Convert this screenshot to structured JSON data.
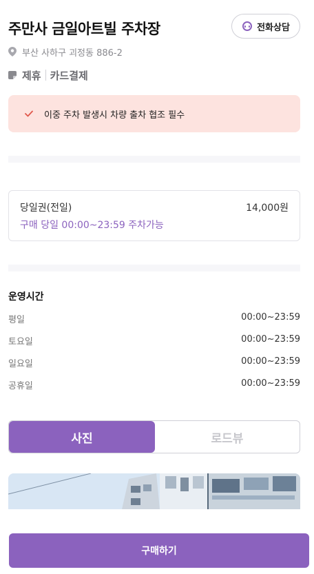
{
  "header": {
    "title": "주만사 금일아트빌 주차장",
    "call_button": "전화상담"
  },
  "address": "부산 사하구 괴정동 886-2",
  "tags": [
    "제휴",
    "카드결제"
  ],
  "notice": "이중 주차 발생시 차량 출차 협조 필수",
  "ticket": {
    "name": "당일권(전일)",
    "price": "14,000원",
    "description": "구매 당일 00:00~23:59 주차가능"
  },
  "hours": {
    "title": "운영시간",
    "rows": [
      {
        "day": "평일",
        "time": "00:00~23:59"
      },
      {
        "day": "토요일",
        "time": "00:00~23:59"
      },
      {
        "day": "일요일",
        "time": "00:00~23:59"
      },
      {
        "day": "공휴일",
        "time": "00:00~23:59"
      }
    ]
  },
  "view_toggle": {
    "options": [
      "사진",
      "로드뷰"
    ],
    "selected": "사진"
  },
  "buy_button": "구매하기",
  "colors": {
    "accent": "#8b62be",
    "notice_bg": "#fde3df",
    "notice_check": "#e0574a"
  }
}
